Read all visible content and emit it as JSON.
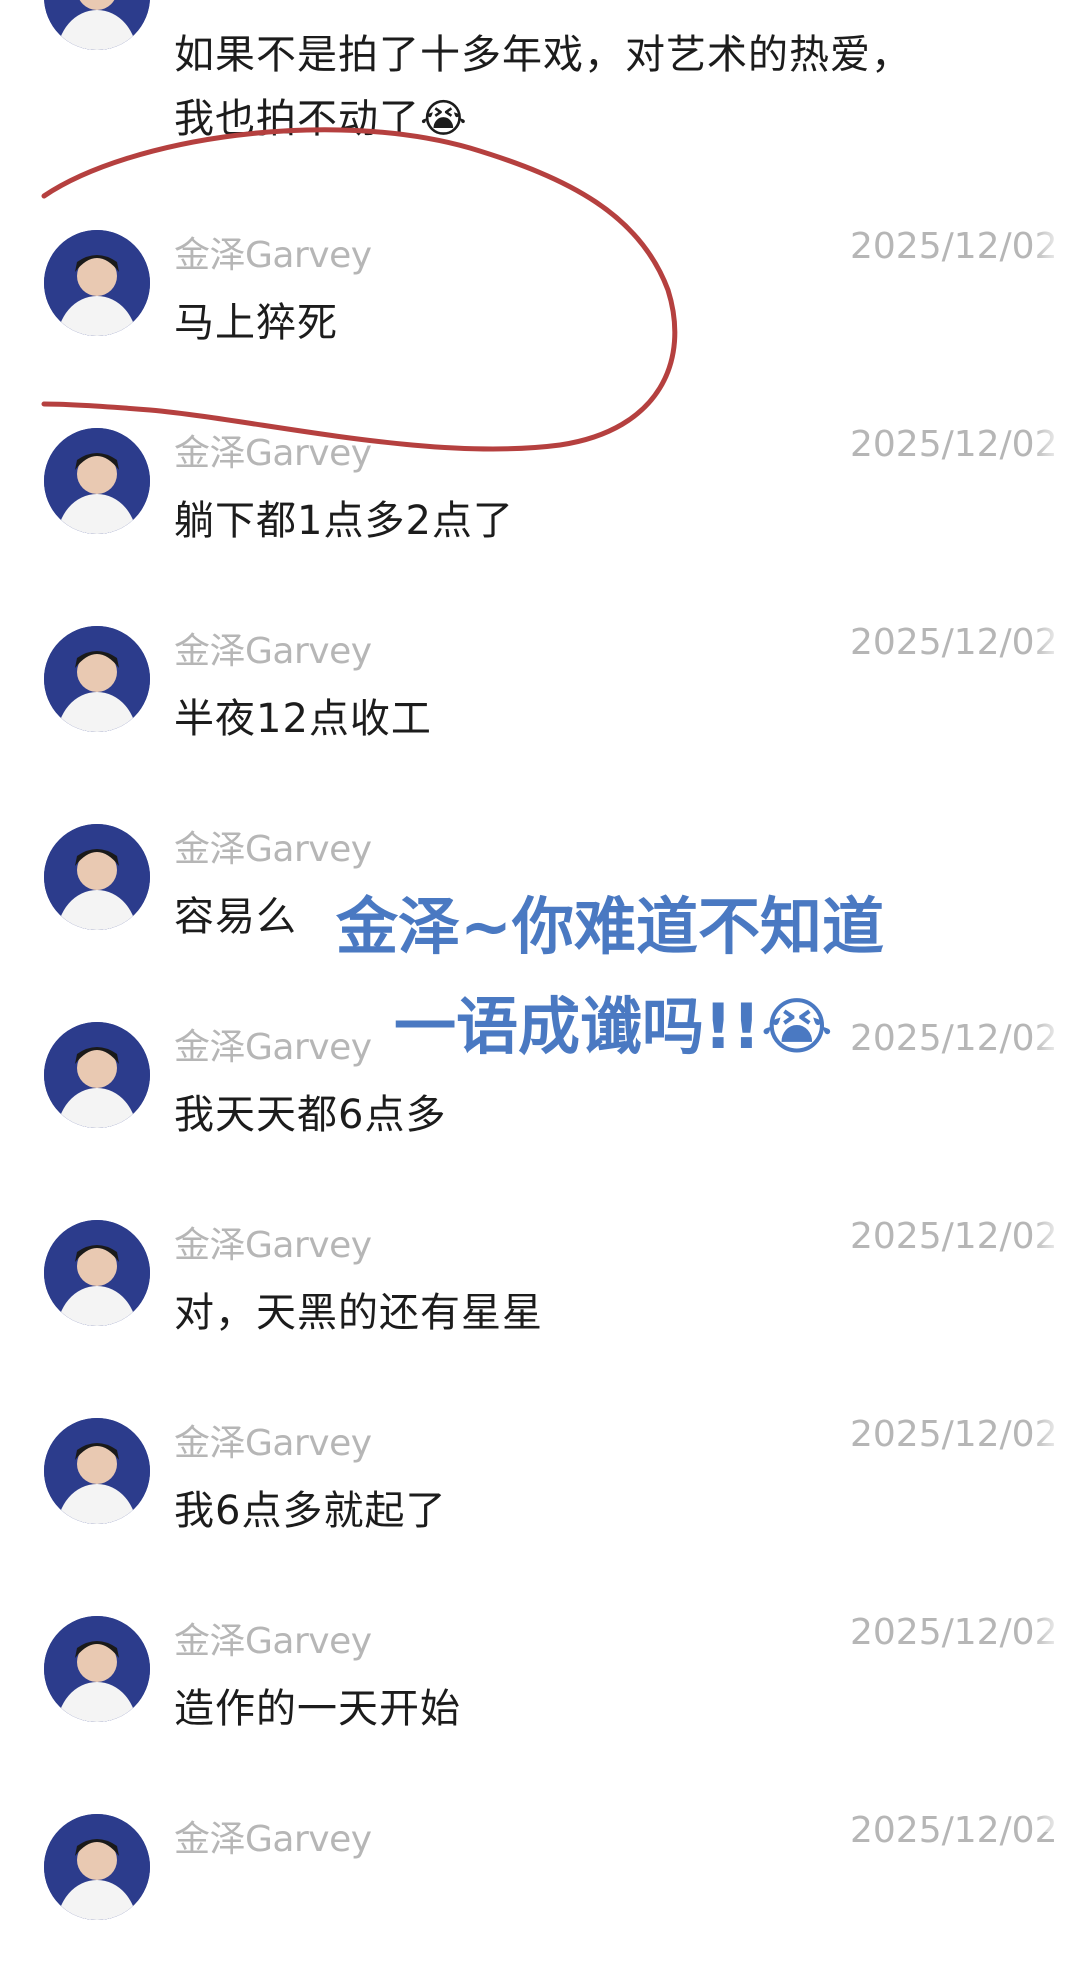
{
  "first_message": {
    "line1": "如果不是拍了十多年戏，对艺术的热爱，",
    "line2": "我也拍不动了",
    "emoji": "😭"
  },
  "messages": [
    {
      "sender": "金泽Garvey",
      "time": "2025/12/02",
      "text": "马上猝死"
    },
    {
      "sender": "金泽Garvey",
      "time": "2025/12/02",
      "text": "躺下都1点多2点了"
    },
    {
      "sender": "金泽Garvey",
      "time": "2025/12/02",
      "text": "半夜12点收工"
    },
    {
      "sender": "金泽Garvey",
      "time": "",
      "text": "容易么"
    },
    {
      "sender": "金泽Garvey",
      "time": "2025/12/02",
      "text": "我天天都6点多"
    },
    {
      "sender": "金泽Garvey",
      "time": "2025/12/02",
      "text": "对，天黑的还有星星"
    },
    {
      "sender": "金泽Garvey",
      "time": "2025/12/02",
      "text": "我6点多就起了"
    },
    {
      "sender": "金泽Garvey",
      "time": "2025/12/02",
      "text": "造作的一天开始"
    },
    {
      "sender": "金泽Garvey",
      "time": "2025/12/02",
      "text": ""
    }
  ],
  "overlay": {
    "line1": "金泽~你难道不知道",
    "line2": "一语成谶吗!!",
    "emoji": "😭"
  },
  "colors": {
    "annotation_circle": "#b5403f",
    "overlay_text": "#4a79c2",
    "sender_gray": "#b6b6b6",
    "avatar_blue": "#2c3c8c"
  }
}
